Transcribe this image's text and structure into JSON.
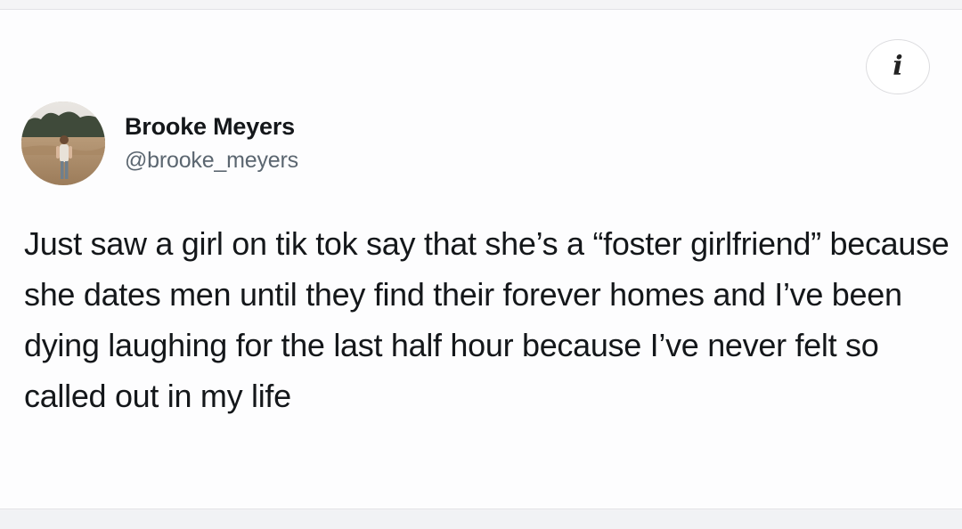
{
  "tweet": {
    "author_name": "Brooke Meyers",
    "author_handle": "@brooke_meyers",
    "text": "Just saw a girl on tik tok say that she’s a “foster girlfriend” because she dates men until they find their forever homes and I’ve been dying laughing for the last half hour because I’ve never felt so called out in my life"
  },
  "info_button": {
    "icon": "info-icon",
    "glyph": "i"
  },
  "colors": {
    "card_background": "#fdfdfe",
    "text_primary": "#14171a",
    "text_secondary": "#5b6670"
  }
}
